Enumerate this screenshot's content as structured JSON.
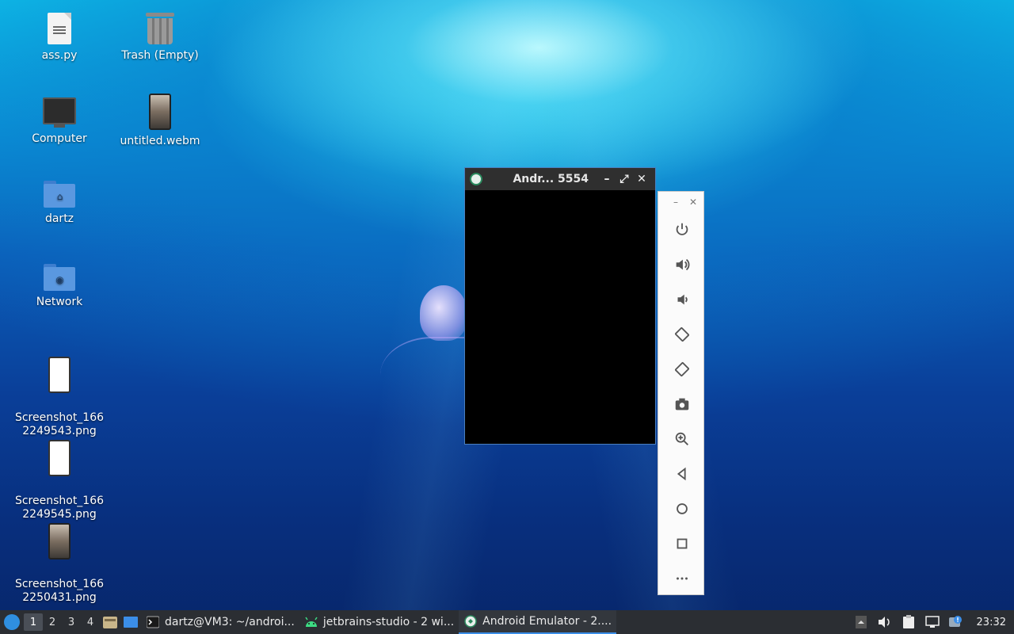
{
  "desktop": {
    "icons": [
      {
        "label": "ass.py",
        "type": "text-file-icon"
      },
      {
        "label": "Trash (Empty)",
        "type": "trash-icon"
      },
      {
        "label": "Computer",
        "type": "computer-icon"
      },
      {
        "label": "untitled.webm",
        "type": "video-file-icon"
      },
      {
        "label": "dartz",
        "type": "home-folder-icon"
      },
      {
        "label": "Network",
        "type": "network-folder-icon"
      },
      {
        "label": "Screenshot_166\n2249543.png",
        "type": "image-file-icon"
      },
      {
        "label": "Screenshot_166\n2249545.png",
        "type": "image-file-icon"
      },
      {
        "label": "Screenshot_166\n2250431.png",
        "type": "image-file-icon"
      }
    ]
  },
  "emulator_window": {
    "title": "Andr... 5554",
    "minimize": "–",
    "maximize": "⤢",
    "close": "✕"
  },
  "emulator_toolbar": {
    "minimize": "–",
    "close": "✕",
    "tools": [
      "power-icon",
      "volume-up-icon",
      "volume-down-icon",
      "rotate-left-icon",
      "rotate-right-icon",
      "camera-icon",
      "zoom-icon",
      "back-icon",
      "home-icon",
      "overview-icon",
      "more-icon"
    ]
  },
  "taskbar": {
    "workspaces": [
      "1",
      "2",
      "3",
      "4"
    ],
    "active_workspace": "1",
    "tasks": [
      {
        "label": "dartz@VM3: ~/androi...",
        "icon": "terminal-icon"
      },
      {
        "label": "jetbrains-studio - 2 wi...",
        "icon": "android-icon"
      },
      {
        "label": "Android Emulator - 2....",
        "icon": "emulator-icon"
      }
    ],
    "clock": "23:32"
  },
  "colors": {
    "accent": "#3b8ee8",
    "taskbar_bg": "#2b2e33"
  }
}
